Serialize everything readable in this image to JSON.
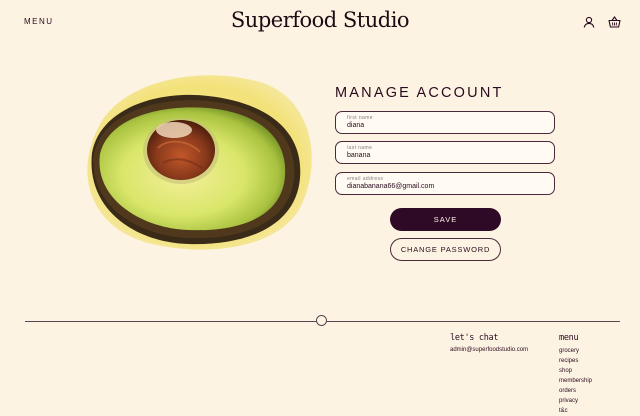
{
  "header": {
    "menu_label": "MENU",
    "brand": "Superfood Studio",
    "icons": [
      "user-icon",
      "basket-icon"
    ]
  },
  "account": {
    "heading": "MANAGE ACCOUNT",
    "fields": {
      "first_name": {
        "label": "first name",
        "value": "diana"
      },
      "last_name": {
        "label": "last name",
        "value": "banana"
      },
      "email": {
        "label": "email address",
        "value": "dianabanana66@gmail.com"
      }
    },
    "save_label": "SAVE",
    "change_password_label": "CHANGE PASSWORD"
  },
  "footer": {
    "chat_heading": "let's chat",
    "chat_email": "admin@superfoodstudio.com",
    "menu_heading": "menu",
    "menu_items": [
      "grocery",
      "recipes",
      "shop",
      "membership",
      "orders",
      "privacy",
      "t&c"
    ]
  },
  "colors": {
    "background": "#fdf3e3",
    "primary": "#2e0a26",
    "accent_halo": "#f3e27a"
  }
}
